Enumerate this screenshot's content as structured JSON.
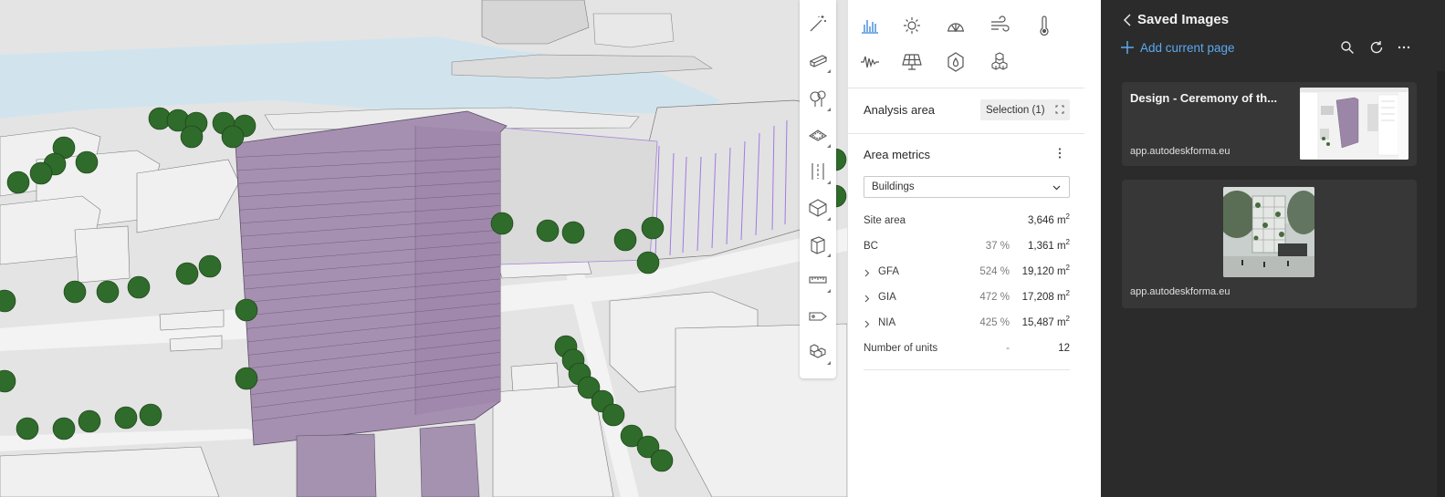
{
  "toolbar": {
    "tools": [
      "magic-wand-icon",
      "wall-icon",
      "tree-icon",
      "surface-icon",
      "road-icon",
      "volume-icon",
      "building-icon",
      "measure-icon",
      "tag-icon",
      "cubes-icon"
    ]
  },
  "panel": {
    "tabs_row1": [
      "bar-chart-icon",
      "sun-icon",
      "dome-icon",
      "wind-icon",
      "thermometer-icon"
    ],
    "tabs_row2": [
      "noise-wave-icon",
      "solar-panel-icon",
      "drop-icon",
      "stacked-cubes-icon"
    ],
    "analysis_area_label": "Analysis area",
    "selection_label": "Selection (1)",
    "area_metrics_label": "Area metrics",
    "dropdown_value": "Buildings",
    "rows": [
      {
        "name": "Site area",
        "pct": "",
        "value": "3,646 m",
        "unit_sup": "2",
        "expandable": false
      },
      {
        "name": "BC",
        "pct": "37 %",
        "value": "1,361 m",
        "unit_sup": "2",
        "expandable": false
      },
      {
        "name": "GFA",
        "pct": "524 %",
        "value": "19,120 m",
        "unit_sup": "2",
        "expandable": true
      },
      {
        "name": "GIA",
        "pct": "472 %",
        "value": "17,208 m",
        "unit_sup": "2",
        "expandable": true
      },
      {
        "name": "NIA",
        "pct": "425 %",
        "value": "15,487 m",
        "unit_sup": "2",
        "expandable": true
      },
      {
        "name": "Number of units",
        "pct": "-",
        "value": "12",
        "unit_sup": "",
        "expandable": false
      }
    ]
  },
  "saved": {
    "title": "Saved Images",
    "add_label": "Add current page",
    "cards": [
      {
        "title": "Design - Ceremony of th...",
        "url": "app.autodeskforma.eu"
      },
      {
        "title": "",
        "url": "app.autodeskforma.eu"
      }
    ]
  },
  "colors": {
    "accent": "#2f7fd6",
    "link": "#5aa9f0",
    "highlight_building": "#a893b0",
    "tree": "#2f6b2a",
    "water": "#cfe3ef"
  }
}
